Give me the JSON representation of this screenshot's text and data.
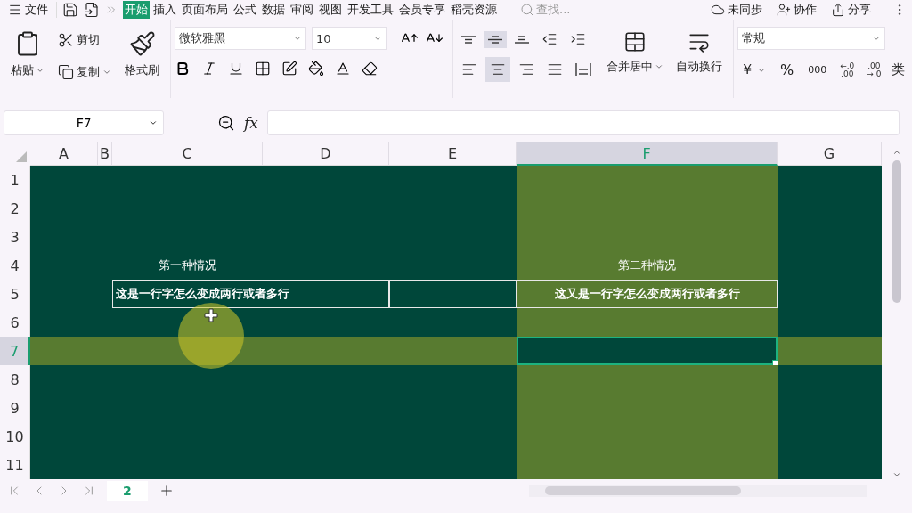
{
  "top_bar": {
    "file_menu": "文件",
    "tabs": [
      {
        "label": "开始",
        "selected": true
      },
      {
        "label": "插入",
        "selected": false
      },
      {
        "label": "页面布局",
        "selected": false
      },
      {
        "label": "公式",
        "selected": false
      },
      {
        "label": "数据",
        "selected": false
      },
      {
        "label": "审阅",
        "selected": false
      },
      {
        "label": "视图",
        "selected": false
      },
      {
        "label": "开发工具",
        "selected": false
      },
      {
        "label": "会员专享",
        "selected": false
      },
      {
        "label": "稻壳资源",
        "selected": false
      }
    ],
    "search": {
      "placeholder": "查找..."
    },
    "actions": [
      {
        "kind": "sync",
        "label": "未同步"
      },
      {
        "kind": "collab",
        "label": "协作"
      },
      {
        "kind": "share",
        "label": "分享"
      }
    ]
  },
  "ribbon": {
    "paste": "粘贴",
    "cut": "剪切",
    "copy": "复制",
    "format_painter": "格式刷",
    "font": {
      "name": "微软雅黑",
      "size": "10"
    },
    "alignment": [
      {
        "kind": "top",
        "selected": false
      },
      {
        "kind": "middle",
        "selected": true
      },
      {
        "kind": "bottom",
        "selected": false
      },
      {
        "kind": "outdent",
        "selected": false
      },
      {
        "kind": "indent",
        "selected": false
      },
      {
        "kind": "left",
        "selected": false
      },
      {
        "kind": "center",
        "selected": true
      },
      {
        "kind": "right",
        "selected": false
      },
      {
        "kind": "justify",
        "selected": false
      },
      {
        "kind": "distribute",
        "selected": false
      }
    ],
    "merge": "合并居中",
    "wrap": "自动换行",
    "number_format": "常规",
    "currency": "￥",
    "percent": "%",
    "thousands": "000",
    "decimals": [
      [
        "←.0",
        ".00"
      ],
      [
        ".00",
        "→.0"
      ]
    ],
    "more": "类"
  },
  "formula_bar": {
    "name_box": "F7",
    "fx": "fx"
  },
  "sheet": {
    "columns": [
      {
        "label": "A",
        "selected": false
      },
      {
        "label": "B",
        "selected": false
      },
      {
        "label": "C",
        "selected": false
      },
      {
        "label": "D",
        "selected": false
      },
      {
        "label": "E",
        "selected": false
      },
      {
        "label": "F",
        "selected": true
      },
      {
        "label": "G",
        "selected": false
      }
    ],
    "rows": [
      {
        "label": "1",
        "selected": false
      },
      {
        "label": "2",
        "selected": false
      },
      {
        "label": "3",
        "selected": false
      },
      {
        "label": "4",
        "selected": false,
        "cells": [
          null,
          null,
          {
            "text": "第一种情况",
            "bold": false,
            "centered": true,
            "bordered": false
          },
          null,
          null,
          {
            "text": "第二种情况",
            "bold": false,
            "centered": true,
            "bordered": false
          },
          null
        ]
      },
      {
        "label": "5",
        "selected": false,
        "cells": [
          null,
          null,
          {
            "text": "这是一行字怎么变成两行或者多行",
            "bold": true,
            "centered": false,
            "bordered": true,
            "merged_right": true
          },
          null,
          {
            "bordered": true
          },
          {
            "text": "这又是一行字怎么变成两行或者多行",
            "bold": true,
            "centered": true,
            "bordered": true
          },
          null
        ]
      },
      {
        "label": "6",
        "selected": false
      },
      {
        "label": "7",
        "selected": true
      },
      {
        "label": "8",
        "selected": false
      },
      {
        "label": "9",
        "selected": false
      },
      {
        "label": "10",
        "selected": false
      },
      {
        "label": "11",
        "selected": false
      }
    ]
  },
  "sheet_tabs": [
    {
      "label": "2",
      "selected": true
    }
  ]
}
